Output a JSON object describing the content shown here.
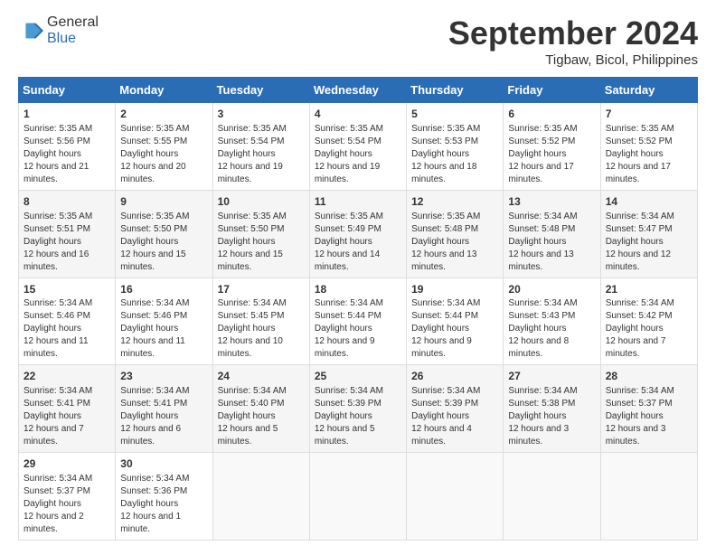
{
  "header": {
    "logo_general": "General",
    "logo_blue": "Blue",
    "month_year": "September 2024",
    "location": "Tigbaw, Bicol, Philippines"
  },
  "calendar": {
    "days_of_week": [
      "Sunday",
      "Monday",
      "Tuesday",
      "Wednesday",
      "Thursday",
      "Friday",
      "Saturday"
    ],
    "weeks": [
      [
        {
          "day": "",
          "content": ""
        },
        {
          "day": "",
          "content": ""
        },
        {
          "day": "",
          "content": ""
        },
        {
          "day": "",
          "content": ""
        },
        {
          "day": "",
          "content": ""
        },
        {
          "day": "",
          "content": ""
        },
        {
          "day": "",
          "content": ""
        }
      ]
    ],
    "cells": [
      {
        "date": 1,
        "col": 0,
        "sunrise": "5:35 AM",
        "sunset": "5:56 PM",
        "daylight": "12 hours and 21 minutes."
      },
      {
        "date": 2,
        "col": 1,
        "sunrise": "5:35 AM",
        "sunset": "5:55 PM",
        "daylight": "12 hours and 20 minutes."
      },
      {
        "date": 3,
        "col": 2,
        "sunrise": "5:35 AM",
        "sunset": "5:54 PM",
        "daylight": "12 hours and 19 minutes."
      },
      {
        "date": 4,
        "col": 3,
        "sunrise": "5:35 AM",
        "sunset": "5:54 PM",
        "daylight": "12 hours and 19 minutes."
      },
      {
        "date": 5,
        "col": 4,
        "sunrise": "5:35 AM",
        "sunset": "5:53 PM",
        "daylight": "12 hours and 18 minutes."
      },
      {
        "date": 6,
        "col": 5,
        "sunrise": "5:35 AM",
        "sunset": "5:52 PM",
        "daylight": "12 hours and 17 minutes."
      },
      {
        "date": 7,
        "col": 6,
        "sunrise": "5:35 AM",
        "sunset": "5:52 PM",
        "daylight": "12 hours and 17 minutes."
      },
      {
        "date": 8,
        "col": 0,
        "sunrise": "5:35 AM",
        "sunset": "5:51 PM",
        "daylight": "12 hours and 16 minutes."
      },
      {
        "date": 9,
        "col": 1,
        "sunrise": "5:35 AM",
        "sunset": "5:50 PM",
        "daylight": "12 hours and 15 minutes."
      },
      {
        "date": 10,
        "col": 2,
        "sunrise": "5:35 AM",
        "sunset": "5:50 PM",
        "daylight": "12 hours and 15 minutes."
      },
      {
        "date": 11,
        "col": 3,
        "sunrise": "5:35 AM",
        "sunset": "5:49 PM",
        "daylight": "12 hours and 14 minutes."
      },
      {
        "date": 12,
        "col": 4,
        "sunrise": "5:35 AM",
        "sunset": "5:48 PM",
        "daylight": "12 hours and 13 minutes."
      },
      {
        "date": 13,
        "col": 5,
        "sunrise": "5:34 AM",
        "sunset": "5:48 PM",
        "daylight": "12 hours and 13 minutes."
      },
      {
        "date": 14,
        "col": 6,
        "sunrise": "5:34 AM",
        "sunset": "5:47 PM",
        "daylight": "12 hours and 12 minutes."
      },
      {
        "date": 15,
        "col": 0,
        "sunrise": "5:34 AM",
        "sunset": "5:46 PM",
        "daylight": "12 hours and 11 minutes."
      },
      {
        "date": 16,
        "col": 1,
        "sunrise": "5:34 AM",
        "sunset": "5:46 PM",
        "daylight": "12 hours and 11 minutes."
      },
      {
        "date": 17,
        "col": 2,
        "sunrise": "5:34 AM",
        "sunset": "5:45 PM",
        "daylight": "12 hours and 10 minutes."
      },
      {
        "date": 18,
        "col": 3,
        "sunrise": "5:34 AM",
        "sunset": "5:44 PM",
        "daylight": "12 hours and 9 minutes."
      },
      {
        "date": 19,
        "col": 4,
        "sunrise": "5:34 AM",
        "sunset": "5:44 PM",
        "daylight": "12 hours and 9 minutes."
      },
      {
        "date": 20,
        "col": 5,
        "sunrise": "5:34 AM",
        "sunset": "5:43 PM",
        "daylight": "12 hours and 8 minutes."
      },
      {
        "date": 21,
        "col": 6,
        "sunrise": "5:34 AM",
        "sunset": "5:42 PM",
        "daylight": "12 hours and 7 minutes."
      },
      {
        "date": 22,
        "col": 0,
        "sunrise": "5:34 AM",
        "sunset": "5:41 PM",
        "daylight": "12 hours and 7 minutes."
      },
      {
        "date": 23,
        "col": 1,
        "sunrise": "5:34 AM",
        "sunset": "5:41 PM",
        "daylight": "12 hours and 6 minutes."
      },
      {
        "date": 24,
        "col": 2,
        "sunrise": "5:34 AM",
        "sunset": "5:40 PM",
        "daylight": "12 hours and 5 minutes."
      },
      {
        "date": 25,
        "col": 3,
        "sunrise": "5:34 AM",
        "sunset": "5:39 PM",
        "daylight": "12 hours and 5 minutes."
      },
      {
        "date": 26,
        "col": 4,
        "sunrise": "5:34 AM",
        "sunset": "5:39 PM",
        "daylight": "12 hours and 4 minutes."
      },
      {
        "date": 27,
        "col": 5,
        "sunrise": "5:34 AM",
        "sunset": "5:38 PM",
        "daylight": "12 hours and 3 minutes."
      },
      {
        "date": 28,
        "col": 6,
        "sunrise": "5:34 AM",
        "sunset": "5:37 PM",
        "daylight": "12 hours and 3 minutes."
      },
      {
        "date": 29,
        "col": 0,
        "sunrise": "5:34 AM",
        "sunset": "5:37 PM",
        "daylight": "12 hours and 2 minutes."
      },
      {
        "date": 30,
        "col": 1,
        "sunrise": "5:34 AM",
        "sunset": "5:36 PM",
        "daylight": "12 hours and 1 minute."
      }
    ],
    "labels": {
      "sunrise": "Sunrise:",
      "sunset": "Sunset:",
      "daylight": "Daylight hours"
    }
  }
}
